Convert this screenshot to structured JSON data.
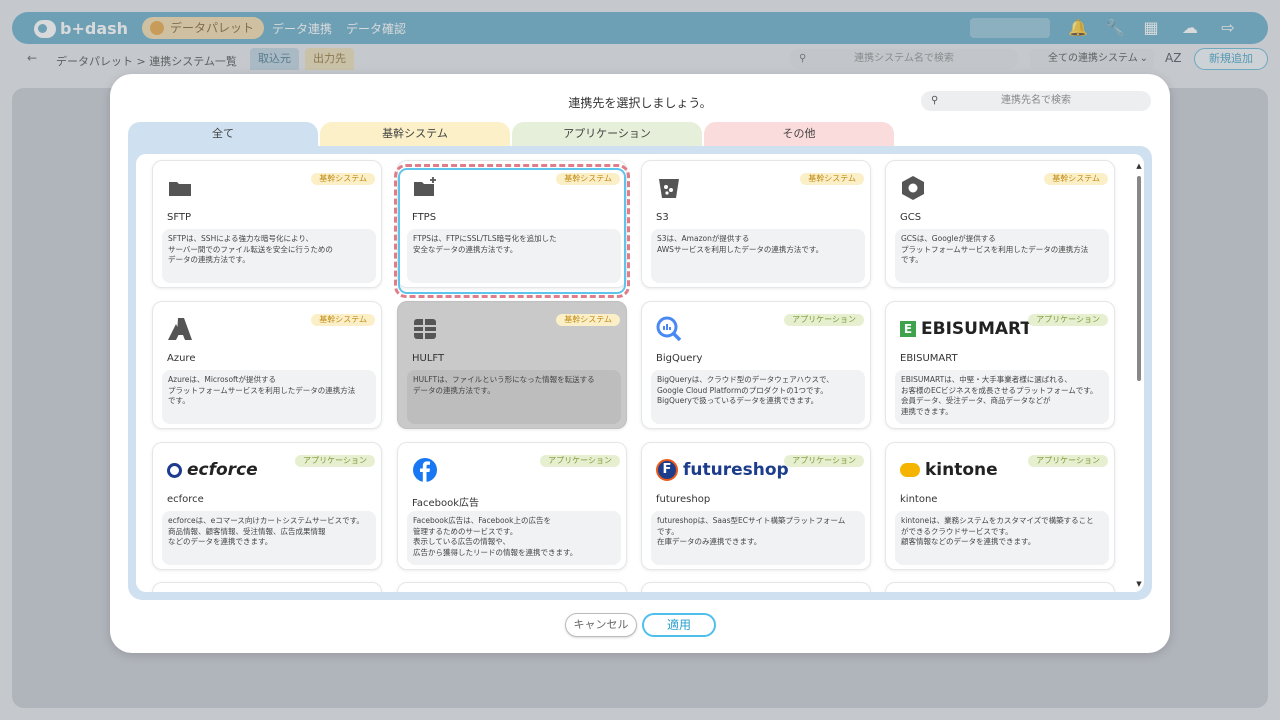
{
  "app": {
    "logo_text": "b+dash",
    "palette_label": "データパレット",
    "nav": [
      "データ連携",
      "データ確認"
    ]
  },
  "subbar": {
    "breadcrumb": "データパレット > 連携システム一覧",
    "tabs": [
      "取込元",
      "出力先"
    ],
    "search_placeholder": "連携システム名で検索",
    "filter_value": "全ての連携システム",
    "sort_label": "AZ",
    "new_button": "新規追加"
  },
  "modal": {
    "title": "連携先を選択しましょう。",
    "search_placeholder": "連携先名で検索",
    "tabs": [
      "全て",
      "基幹システム",
      "アプリケーション",
      "その他"
    ],
    "cancel_label": "キャンセル",
    "apply_label": "適用",
    "cards": [
      {
        "name": "SFTP",
        "badge": "基幹システム",
        "icon": "folder-icon",
        "desc": "SFTPは、SSHによる強力な暗号化により、\nサーバー間でのファイル転送を安全に行うための\nデータの連携方法です。"
      },
      {
        "name": "FTPS",
        "badge": "基幹システム",
        "icon": "folder-plus-icon",
        "desc": "FTPSは、FTPにSSL/TLS暗号化を追加した\n安全なデータの連携方法です。",
        "selected": true
      },
      {
        "name": "S3",
        "badge": "基幹システム",
        "icon": "bucket-icon",
        "desc": "S3は、Amazonが提供する\nAWSサービスを利用したデータの連携方法です。"
      },
      {
        "name": "GCS",
        "badge": "基幹システム",
        "icon": "hexagon-icon",
        "desc": "GCSは、Googleが提供する\nプラットフォームサービスを利用したデータの連携方法\nです。"
      },
      {
        "name": "Azure",
        "badge": "基幹システム",
        "icon": "azure-icon",
        "desc": "Azureは、Microsoftが提供する\nプラットフォームサービスを利用したデータの連携方法\nです。"
      },
      {
        "name": "HULFT",
        "badge": "基幹システム",
        "icon": "hulft-icon",
        "desc": "HULFTは、ファイルという形になった情報を転送する\nデータの連携方法です。",
        "disabled": true
      },
      {
        "name": "BigQuery",
        "badge": "アプリケーション",
        "icon": "bigquery-icon",
        "desc": "BigQueryは、クラウド型のデータウェアハウスで、\nGoogle Cloud Platformのプロダクトの1つです。\nBigQueryで扱っているデータを連携できます。"
      },
      {
        "name": "EBISUMART",
        "badge": "アプリケーション",
        "icon": "ebisumart-logo",
        "logo": "EBISUMART",
        "desc": "EBISUMARTは、中堅・大手事業者様に選ばれる、\nお客様のECビジネスを成長させるプラットフォームです。\n会員データ、受注データ、商品データなどが\n連携できます。"
      },
      {
        "name": "ecforce",
        "badge": "アプリケーション",
        "icon": "ecforce-logo",
        "logo": "ecforce",
        "desc": "ecforceは、eコマース向けカートシステムサービスです。\n商品情報、顧客情報、受注情報、広告成果情報\nなどのデータを連携できます。"
      },
      {
        "name": "Facebook広告",
        "badge": "アプリケーション",
        "icon": "facebook-icon",
        "desc": "Facebook広告は、Facebook上の広告を\n管理するためのサービスです。\n表示している広告の情報や、\n広告から獲得したリードの情報を連携できます。"
      },
      {
        "name": "futureshop",
        "badge": "アプリケーション",
        "icon": "futureshop-logo",
        "logo": "futureshop",
        "desc": "futureshopは、Saas型ECサイト構築プラットフォーム\nです。\n在庫データのみ連携できます。"
      },
      {
        "name": "kintone",
        "badge": "アプリケーション",
        "icon": "kintone-logo",
        "logo": "kintone",
        "desc": "kintoneは、業務システムをカスタマイズで構築すること\nができるクラウドサービスです。\n顧客情報などのデータを連携できます。"
      }
    ]
  },
  "colors": {
    "accent": "#5fa8c6",
    "tab_all": "#cfe1f0",
    "tab_core": "#fbf0c8",
    "tab_app": "#e6efd9",
    "tab_other": "#fbdcdc",
    "selected_border": "#5fc4ec",
    "selected_dash": "#e07d88"
  }
}
